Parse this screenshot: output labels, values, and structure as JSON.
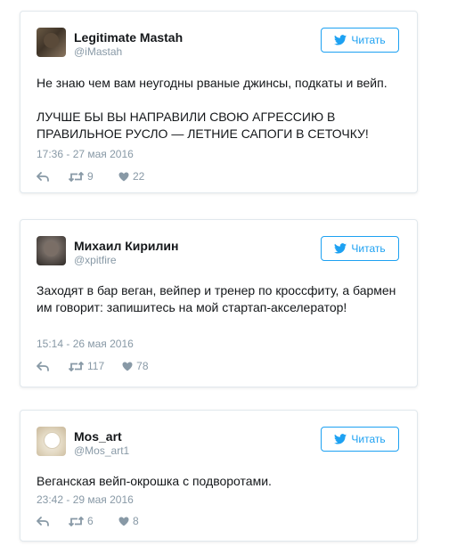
{
  "tweets": [
    {
      "name": "Legitimate Mastah",
      "handle": "@iMastah",
      "follow_label": "Читать",
      "text": "Не знаю чем вам неугодны рваные джинсы, подкаты и вейп.\n\nЛУЧШЕ БЫ ВЫ НАПРАВИЛИ СВОЮ АГРЕССИЮ В ПРАВИЛЬНОЕ РУСЛО — ЛЕТНИЕ САПОГИ В СЕТОЧКУ!",
      "time": "17:36 - 27 мая 2016",
      "retweets": "9",
      "likes": "22"
    },
    {
      "name": "Михаил Кирилин",
      "handle": "@xpitfire",
      "follow_label": "Читать",
      "text": "Заходят в бар веган, вейпер и тренер по кроссфиту, а бармен им говорит: запишитесь на мой стартап-акселератор!",
      "time": "15:14 - 26 мая 2016",
      "retweets": "117",
      "likes": "78"
    },
    {
      "name": "Mos_art",
      "handle": "@Mos_art1",
      "follow_label": "Читать",
      "text": "Веганская вейп-окрошка с подворотами.",
      "time": "23:42 - 29 мая 2016",
      "retweets": "6",
      "likes": "8"
    }
  ],
  "colors": {
    "accent": "#1da1f2",
    "muted": "#8899a6",
    "border": "#e1e8ed"
  },
  "icons": {
    "follow": "twitter-bird-icon",
    "reply": "reply-icon",
    "retweet": "retweet-icon",
    "like": "heart-icon"
  }
}
